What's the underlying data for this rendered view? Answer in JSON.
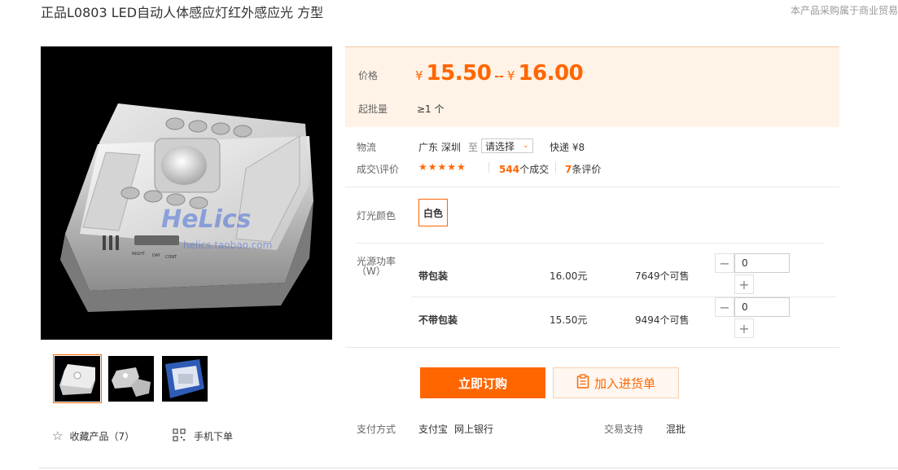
{
  "title": "正品L0803 LED自动人体感应灯红外感应光 方型",
  "notice": "本产品采购属于商业贸易",
  "image": {
    "watermark": "HeLics",
    "watermark_url": "helics.taobao.com",
    "switch_labels": [
      "NIGHT",
      "DAY",
      "CONT"
    ]
  },
  "thumbnails": [
    {
      "name": "thumb-1",
      "selected": true
    },
    {
      "name": "thumb-2",
      "selected": false
    },
    {
      "name": "thumb-3",
      "selected": false
    }
  ],
  "favorite": {
    "label": "收藏产品（7）"
  },
  "mobile_order": {
    "label": "手机下单"
  },
  "price": {
    "label": "价格",
    "currency": "¥",
    "low": "15.50",
    "separator": "--",
    "high": "16.00"
  },
  "min_order": {
    "label": "起批量",
    "value": "≥1 个"
  },
  "logistics": {
    "label": "物流",
    "origin": "广东 深圳",
    "to": "至",
    "destination": "请选择",
    "express": "快递 ¥8"
  },
  "deals": {
    "label": "成交\\评价",
    "stars": "★★★★★",
    "sold_count": "544",
    "sold_suffix": "个成交",
    "review_count": "7",
    "review_suffix": "条评价"
  },
  "light_color": {
    "label": "灯光颜色",
    "option": "白色"
  },
  "power": {
    "label_line1": "光源功率",
    "label_line2": "（W）",
    "rows": [
      {
        "name": "带包装",
        "price": "16.00元",
        "stock": "7649个可售",
        "qty": "0"
      },
      {
        "name": "不带包装",
        "price": "15.50元",
        "stock": "9494个可售",
        "qty": "0"
      }
    ]
  },
  "actions": {
    "buy_now": "立即订购",
    "add_to_list": "加入进货单"
  },
  "payment": {
    "label": "支付方式",
    "method1": "支付宝",
    "method2": "网上银行",
    "trade_label": "交易支持",
    "trade_value": "混批"
  },
  "colors": {
    "accent": "#ff6600",
    "price_bg": "#fff2e6"
  }
}
